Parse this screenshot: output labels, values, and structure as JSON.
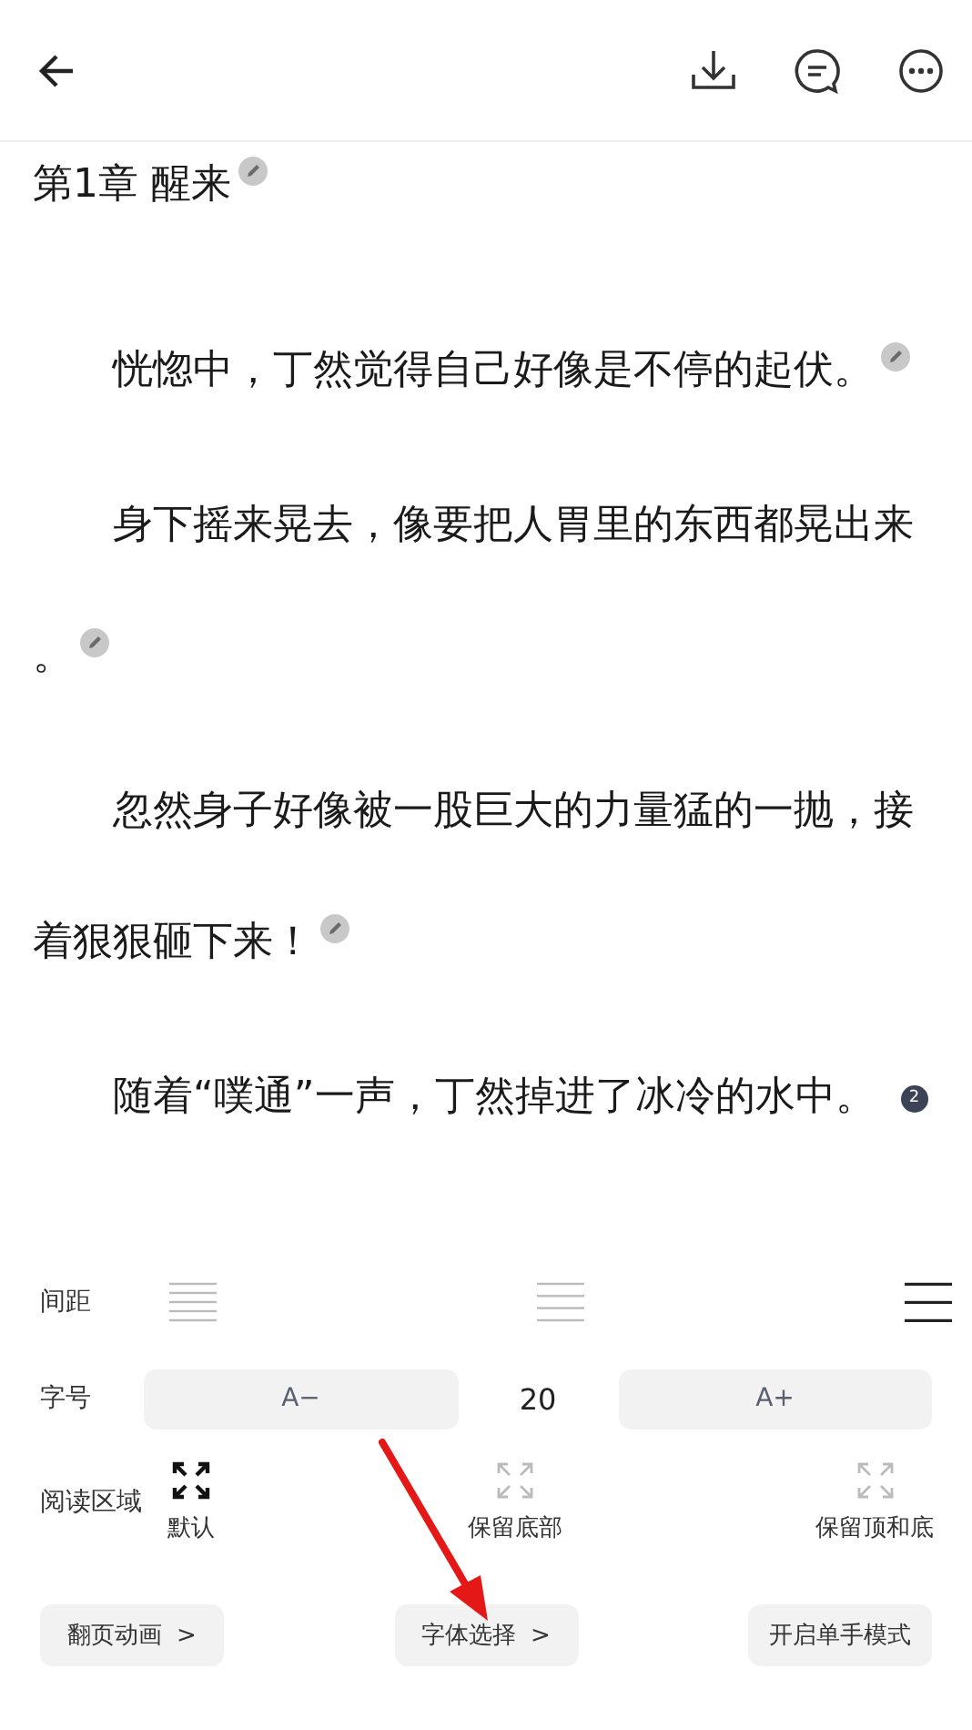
{
  "chapter": {
    "title": "第1章 醒来",
    "mark": {
      "kind": "edit"
    }
  },
  "paragraphs": [
    {
      "lines": [
        "恍惚中，丁然觉得自己好像是不停的起伏。"
      ],
      "mark": {
        "kind": "edit"
      }
    },
    {
      "lines": [
        "身下摇来晃去，像要把人胃里的东西都晃出来",
        "。"
      ],
      "mark": {
        "kind": "edit"
      }
    },
    {
      "lines": [
        "忽然身子好像被一股巨大的力量猛的一抛，接",
        "着狠狠砸下来！"
      ],
      "mark": {
        "kind": "edit"
      }
    },
    {
      "lines": [
        "随着“噗通”一声，丁然掉进了冰冷的水中。"
      ],
      "mark": {
        "kind": "count",
        "text": "2"
      }
    }
  ],
  "settings": {
    "spacing": {
      "label": "间距",
      "options": [
        {
          "selected": false
        },
        {
          "selected": false
        },
        {
          "selected": true
        }
      ]
    },
    "font_size": {
      "label": "字号",
      "decrease": "A−",
      "value": "20",
      "increase": "A+"
    },
    "reading_area": {
      "label": "阅读区域",
      "options": [
        {
          "label": "默认",
          "selected": true
        },
        {
          "label": "保留底部",
          "selected": false
        },
        {
          "label": "保留顶和底",
          "selected": false
        }
      ]
    },
    "buttons": [
      {
        "label": "翻页动画",
        "chevron": ">"
      },
      {
        "label": "字体选择",
        "chevron": ">"
      },
      {
        "label": "开启单手模式"
      }
    ]
  }
}
